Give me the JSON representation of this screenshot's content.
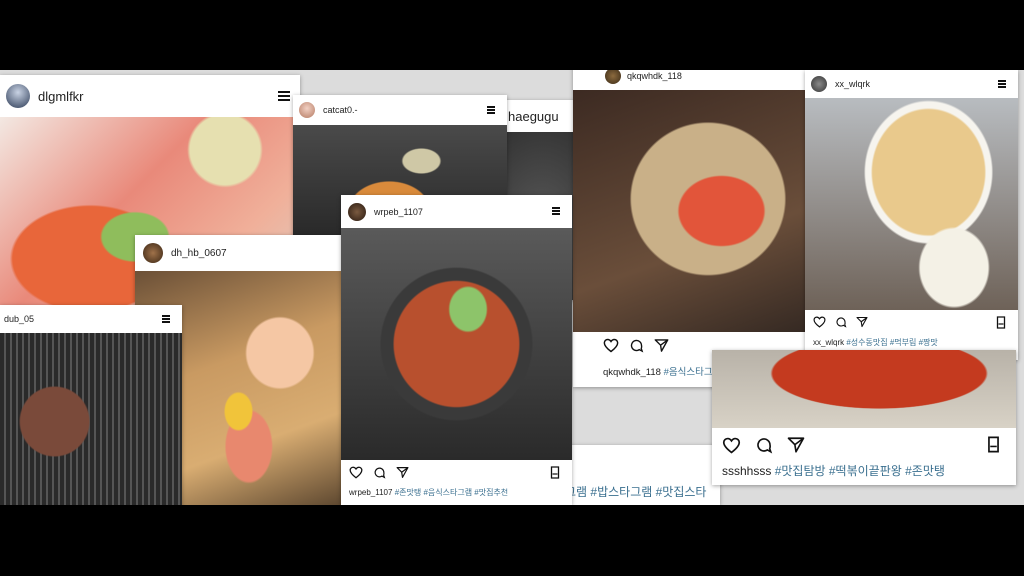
{
  "posts": [
    {
      "username": "dlgmlfkr"
    },
    {
      "username": "catcat0.-"
    },
    {
      "username": "haegugu"
    },
    {
      "username": "qkqwhdk_118",
      "caption_user": "qkqwhdk_118",
      "hashtags": "#음식스타그램 #오늘뭐먹지"
    },
    {
      "username": "xx_wlqrk",
      "caption_user": "xx_wlqrk",
      "hashtags": "#성수동맛집 #먹부림 #짱맛"
    },
    {
      "username": "dh_hb_0607"
    },
    {
      "username": "dub_05"
    },
    {
      "username": "wrpeb_1107",
      "caption_user": "wrpeb_1107",
      "hashtags": "#존맛탱 #음식스타그램 #맛집추천"
    },
    {
      "caption_user": "ssshhsss",
      "hashtags": "#맛집탐방 #떡볶이끝판왕 #존맛탱"
    },
    {
      "hashtags": "그램 #밥스타그램 #맛집스타"
    }
  ],
  "icon_names": [
    "heart-icon",
    "comment-icon",
    "share-icon",
    "bookmark-icon",
    "menu-icon"
  ]
}
